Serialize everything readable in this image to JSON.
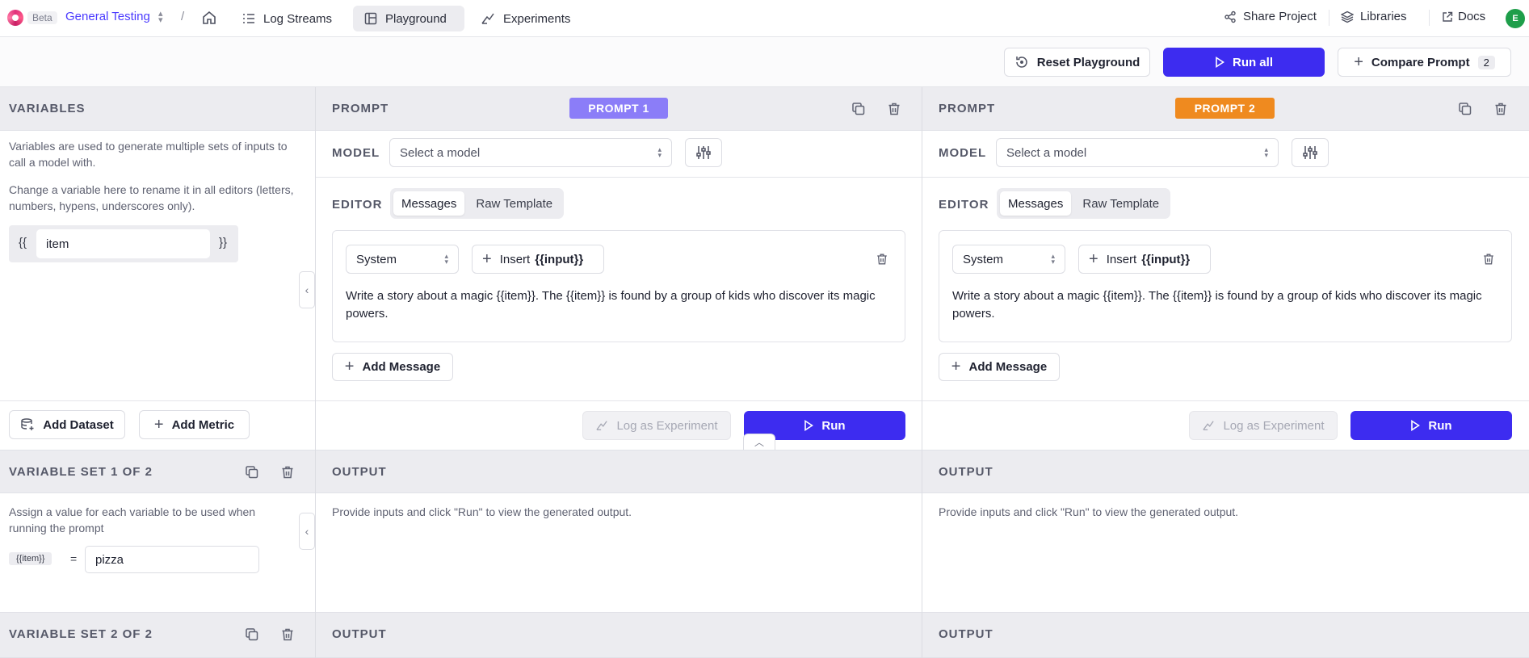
{
  "nav": {
    "beta": "Beta",
    "project": "General Testing",
    "separator": "/",
    "items": [
      {
        "label": "Log Streams",
        "icon": "list-icon"
      },
      {
        "label": "Playground",
        "icon": "layout-icon",
        "active": true
      },
      {
        "label": "Experiments",
        "icon": "flask-icon"
      }
    ],
    "share": "Share Project",
    "libraries": "Libraries",
    "docs": "Docs",
    "avatar_initial": "E"
  },
  "toolbar": {
    "reset": "Reset Playground",
    "run_all": "Run all",
    "compare": "Compare Prompt",
    "compare_count": "2"
  },
  "variables": {
    "title": "VARIABLES",
    "desc1": "Variables are used to generate multiple sets of inputs to call a model with.",
    "desc2": "Change a variable here to rename it in all editors (letters, numbers, hypens, underscores only).",
    "open_brace": "{{",
    "close_brace": "}}",
    "name": "item",
    "add_dataset": "Add Dataset",
    "add_metric": "Add Metric"
  },
  "prompts": [
    {
      "header": "PROMPT",
      "badge": "PROMPT 1",
      "badge_color": "#8b7df8",
      "model_label": "MODEL",
      "model_placeholder": "Select a model",
      "editor_label": "EDITOR",
      "tab_messages": "Messages",
      "tab_raw": "Raw Template",
      "role": "System",
      "insert_prefix": "Insert",
      "insert_token": "{{input}}",
      "message": "Write a story about a magic {{item}}. The {{item}} is found by a group of kids who discover its magic powers.",
      "add_message": "Add Message",
      "log_experiment": "Log as Experiment",
      "run": "Run"
    },
    {
      "header": "PROMPT",
      "badge": "PROMPT 2",
      "badge_color": "#ef8a1f",
      "model_label": "MODEL",
      "model_placeholder": "Select a model",
      "editor_label": "EDITOR",
      "tab_messages": "Messages",
      "tab_raw": "Raw Template",
      "role": "System",
      "insert_prefix": "Insert",
      "insert_token": "{{input}}",
      "message": "Write a story about a magic {{item}}. The {{item}} is found by a group of kids who discover its magic powers.",
      "add_message": "Add Message",
      "log_experiment": "Log as Experiment",
      "run": "Run"
    }
  ],
  "variable_sets": [
    {
      "title": "VARIABLE SET 1 OF 2",
      "desc": "Assign a value for each variable to be used when running the prompt",
      "var_tag": "{{item}}",
      "equals": "=",
      "value": "pizza"
    },
    {
      "title": "VARIABLE SET 2 OF 2"
    }
  ],
  "output": {
    "label": "OUTPUT",
    "placeholder": "Provide inputs and click \"Run\" to view the generated output."
  },
  "colors": {
    "primary": "#3d2cf0",
    "project_link": "#4a3aff",
    "avatar": "#1e9e4a"
  }
}
